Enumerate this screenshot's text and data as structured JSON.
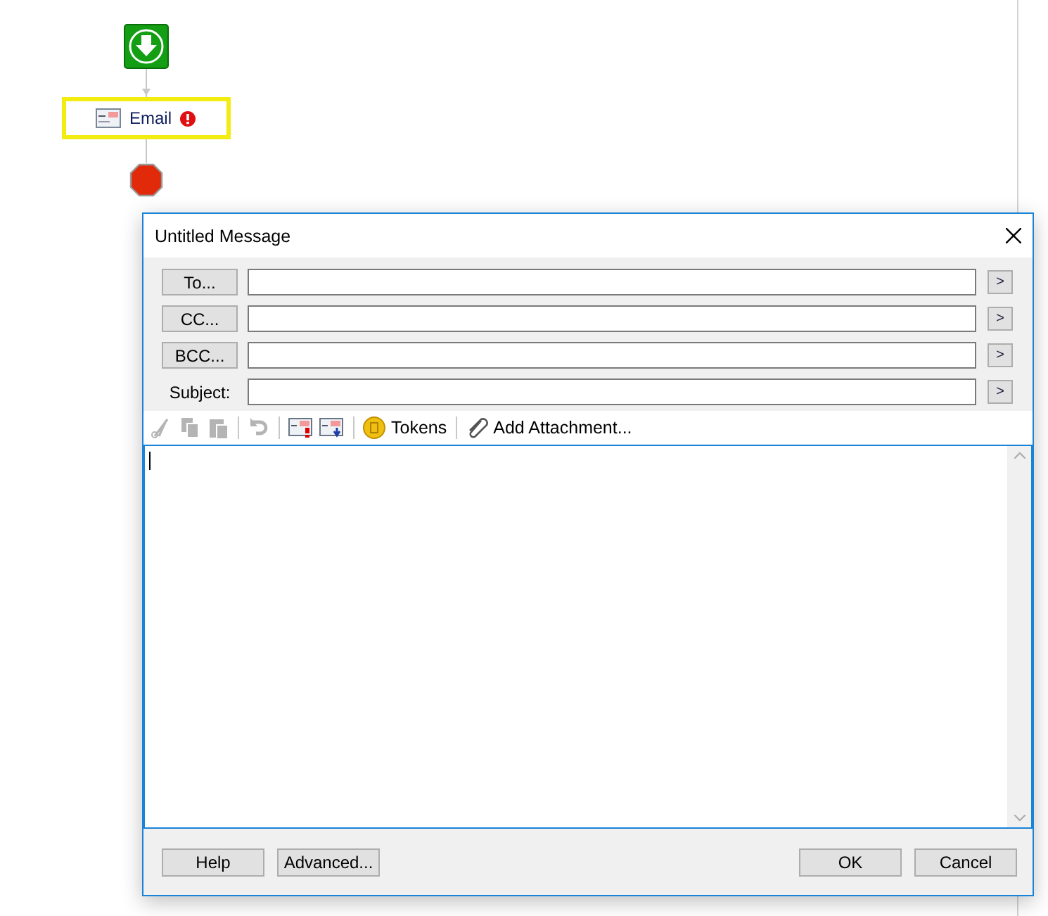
{
  "flow": {
    "nodes": [
      {
        "kind": "start"
      },
      {
        "kind": "action",
        "label": "Email",
        "error": true,
        "selected": true
      },
      {
        "kind": "stop"
      }
    ]
  },
  "dialog": {
    "title": "Untitled Message",
    "fields": [
      {
        "label": "To...",
        "kind": "button",
        "more": ">"
      },
      {
        "label": "CC...",
        "kind": "button",
        "more": ">"
      },
      {
        "label": "BCC...",
        "kind": "button",
        "more": ">"
      },
      {
        "label": "Subject:",
        "kind": "label",
        "more": ">"
      }
    ],
    "toolbar": [
      {
        "kind": "cut",
        "disabled": true
      },
      {
        "kind": "copy",
        "disabled": true
      },
      {
        "kind": "paste",
        "disabled": true
      },
      {
        "kind": "sep"
      },
      {
        "kind": "undo",
        "disabled": true
      },
      {
        "kind": "sep"
      },
      {
        "kind": "mail-flag",
        "disabled": false
      },
      {
        "kind": "mail-down",
        "disabled": false
      },
      {
        "kind": "sep"
      },
      {
        "kind": "coin",
        "label": "Tokens",
        "disabled": false
      },
      {
        "kind": "sep"
      },
      {
        "kind": "clip",
        "label": "Add Attachment...",
        "disabled": false
      }
    ],
    "footer_left": [
      "Help",
      "Advanced..."
    ],
    "footer_right": [
      "OK",
      "Cancel"
    ]
  }
}
